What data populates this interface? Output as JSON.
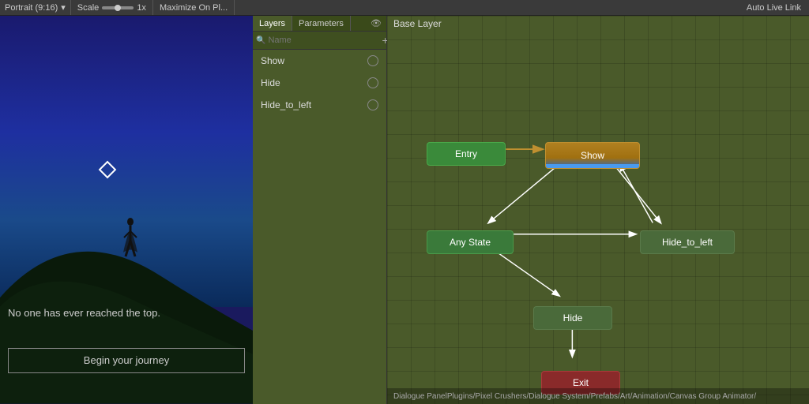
{
  "topbar": {
    "portrait_label": "Portrait (9:16)",
    "scale_label": "Scale",
    "scale_value": "1x",
    "maximize_label": "Maximize On Pl...",
    "auto_live_link": "Auto Live Link"
  },
  "layers_panel": {
    "tabs": [
      {
        "id": "layers",
        "label": "Layers",
        "active": true
      },
      {
        "id": "parameters",
        "label": "Parameters",
        "active": false
      }
    ],
    "search_placeholder": "Name",
    "add_button": "+",
    "items": [
      {
        "id": "show",
        "label": "Show",
        "active": false
      },
      {
        "id": "hide",
        "label": "Hide",
        "active": false
      },
      {
        "id": "hide_to_left",
        "label": "Hide_to_left",
        "active": false
      }
    ]
  },
  "state_machine": {
    "title": "Base Layer",
    "footer_path": "Dialogue PanelPlugins/Pixel Crushers/Dialogue System/Prefabs/Art/Animation/Canvas Group Animator/",
    "nodes": {
      "entry": {
        "label": "Entry"
      },
      "show": {
        "label": "Show"
      },
      "any_state": {
        "label": "Any State"
      },
      "hide_to_left": {
        "label": "Hide_to_left"
      },
      "hide": {
        "label": "Hide"
      },
      "exit": {
        "label": "Exit"
      }
    }
  },
  "game_preview": {
    "subtitle": "No one has ever reached the top.",
    "button_label": "Begin your journey"
  }
}
